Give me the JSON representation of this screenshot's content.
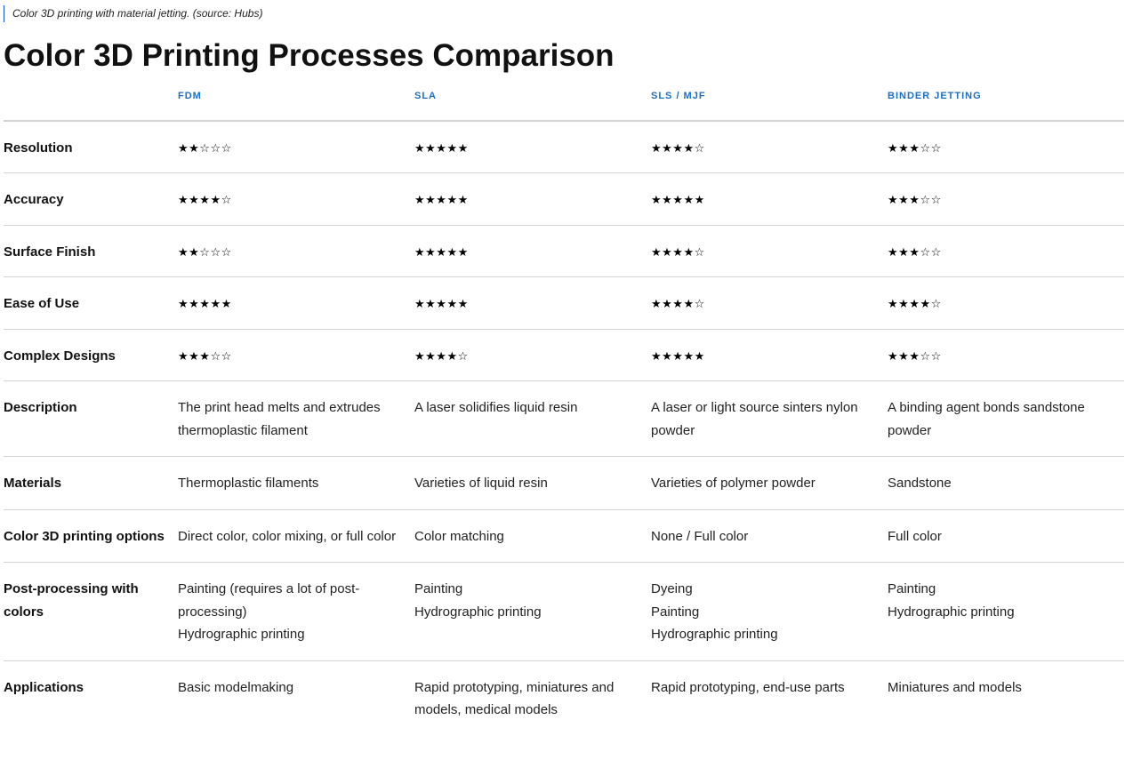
{
  "caption": "Color 3D printing with material jetting. (source: Hubs)",
  "title": "Color 3D Printing Processes Comparison",
  "columns": [
    "FDM",
    "SLA",
    "SLS / MJF",
    "BINDER JETTING"
  ],
  "ratings": [
    {
      "label": "Resolution",
      "values": [
        "★★☆☆☆",
        "★★★★★",
        "★★★★☆",
        "★★★☆☆"
      ],
      "scores": [
        2,
        5,
        4,
        3
      ]
    },
    {
      "label": "Accuracy",
      "values": [
        "★★★★☆",
        "★★★★★",
        "★★★★★",
        "★★★☆☆"
      ],
      "scores": [
        4,
        5,
        5,
        3
      ]
    },
    {
      "label": "Surface Finish",
      "values": [
        "★★☆☆☆",
        "★★★★★",
        "★★★★☆",
        "★★★☆☆"
      ],
      "scores": [
        2,
        5,
        4,
        3
      ]
    },
    {
      "label": "Ease of Use",
      "values": [
        "★★★★★",
        "★★★★★",
        "★★★★☆",
        "★★★★☆"
      ],
      "scores": [
        5,
        5,
        4,
        4
      ]
    },
    {
      "label": "Complex Designs",
      "values": [
        "★★★☆☆",
        "★★★★☆",
        "★★★★★",
        "★★★☆☆"
      ],
      "scores": [
        3,
        4,
        5,
        3
      ]
    }
  ],
  "description": {
    "label": "Description",
    "values": [
      "The print head melts and extrudes thermoplastic filament",
      "A laser solidifies liquid resin",
      "A laser or light source sinters nylon powder",
      "A binding agent bonds sandstone powder"
    ]
  },
  "materials": {
    "label": "Materials",
    "values": [
      "Thermoplastic filaments",
      "Varieties of liquid resin",
      "Varieties of polymer powder",
      "Sandstone"
    ]
  },
  "color_options": {
    "label": "Color 3D printing options",
    "values": [
      "Direct color, color mixing, or full color",
      "Color matching",
      "None / Full color",
      "Full color"
    ]
  },
  "post_processing": {
    "label": "Post-processing with colors",
    "fdm": [
      "Painting (requires a lot of post-processing)",
      "Hydrographic printing"
    ],
    "sla": [
      "Painting",
      "Hydrographic printing"
    ],
    "sls": [
      "Dyeing",
      "Painting",
      "Hydrographic printing"
    ],
    "binder": [
      "Painting",
      "Hydrographic printing"
    ]
  },
  "applications": {
    "label": "Applications",
    "values": [
      "Basic modelmaking",
      "Rapid prototyping, miniatures and models, medical models",
      "Rapid prototyping, end-use parts",
      "Miniatures and models"
    ]
  },
  "colors": {
    "header_accent": "#1a6fc4",
    "caption_rule": "#1a56db",
    "row_divider": "#d4d4d4"
  }
}
